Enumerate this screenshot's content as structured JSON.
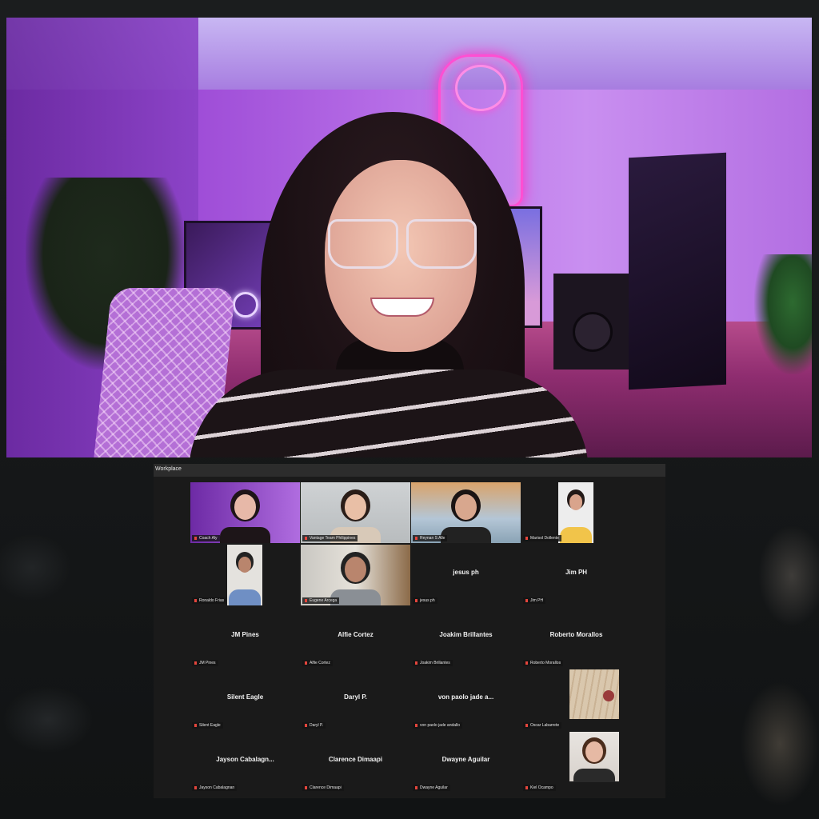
{
  "main_video": {
    "participant": "Coach Aly"
  },
  "zoom": {
    "title": "Workplace",
    "participants": [
      {
        "tag": "Coach Aly",
        "center": ""
      },
      {
        "tag": "Vantage Team Philippines",
        "center": ""
      },
      {
        "tag": "Reynan S Alle",
        "center": ""
      },
      {
        "tag": "Marisol Dollente",
        "center": ""
      },
      {
        "tag": "Ronaldo Frias",
        "center": ""
      },
      {
        "tag": "Eugene Arcega",
        "center": ""
      },
      {
        "tag": "jesus ph",
        "center": "jesus ph"
      },
      {
        "tag": "Jim PH",
        "center": "Jim PH"
      },
      {
        "tag": "JM Pines",
        "center": "JM Pines"
      },
      {
        "tag": "Alfie Cortez",
        "center": "Alfie Cortez"
      },
      {
        "tag": "Joakim Brillantes",
        "center": "Joakim Brillantes"
      },
      {
        "tag": "Roberto Morallos",
        "center": "Roberto Morallos"
      },
      {
        "tag": "Silent Eagle",
        "center": "Silent Eagle"
      },
      {
        "tag": "Daryl P.",
        "center": "Daryl P."
      },
      {
        "tag": "von paolo jade andallo",
        "center": "von paolo jade a..."
      },
      {
        "tag": "Oscar Labarrete",
        "center": ""
      },
      {
        "tag": "Jayson Cabalagnan",
        "center": "Jayson Cabalagn..."
      },
      {
        "tag": "Clarence Dimaapi",
        "center": "Clarence Dimaapi"
      },
      {
        "tag": "Dwayne Aguilar",
        "center": "Dwayne Aguilar"
      },
      {
        "tag": "Kiel Ocampo",
        "center": ""
      }
    ]
  }
}
